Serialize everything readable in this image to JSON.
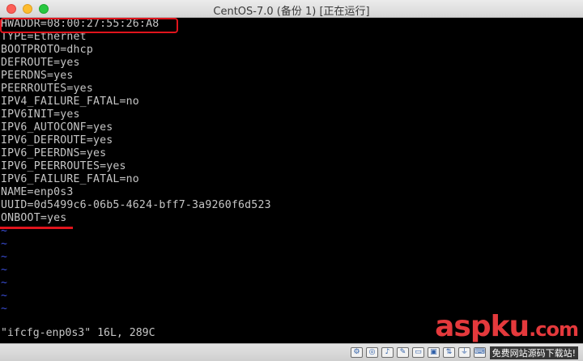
{
  "window": {
    "title": "CentOS-7.0 (备份 1) [正在运行]"
  },
  "terminal": {
    "lines": [
      "HWADDR=08:00:27:55:26:A8",
      "TYPE=Ethernet",
      "BOOTPROTO=dhcp",
      "DEFROUTE=yes",
      "PEERDNS=yes",
      "PEERROUTES=yes",
      "IPV4_FAILURE_FATAL=no",
      "IPV6INIT=yes",
      "IPV6_AUTOCONF=yes",
      "IPV6_DEFROUTE=yes",
      "IPV6_PEERDNS=yes",
      "IPV6_PEERROUTES=yes",
      "IPV6_FAILURE_FATAL=no",
      "NAME=enp0s3",
      "UUID=0d5499c6-06b5-4624-bff7-3a9260f6d523",
      "ONBOOT=yes"
    ],
    "empty_marker": "~",
    "status": "\"ifcfg-enp0s3\" 16L, 289C"
  },
  "highlight_color": "#e0141c",
  "tilde_color": "#3b4fd9",
  "statusbar": {
    "icons": [
      "settings-icon",
      "cd-icon",
      "audio-icon",
      "pencil-icon",
      "folder-icon",
      "display-icon",
      "network-icon",
      "usb-icon",
      "keyboard-icon"
    ]
  },
  "watermark": {
    "logo": "aspku",
    "tld": ".com",
    "subtitle": "免费网站源码下载站!"
  }
}
